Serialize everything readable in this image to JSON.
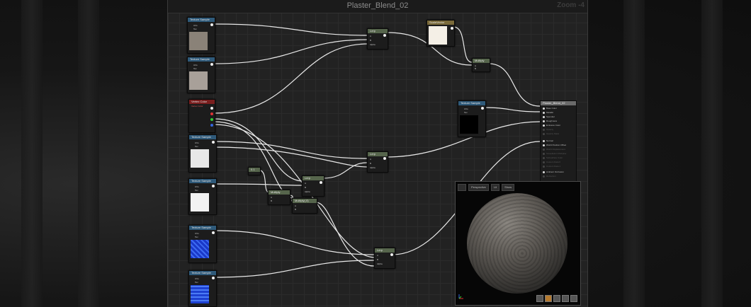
{
  "editor": {
    "title": "Plaster_Blend_02",
    "zoom": "Zoom -4"
  },
  "nodes": {
    "tex1": {
      "header": "Texture Sample",
      "pins": [
        "UVs",
        "Tex"
      ]
    },
    "tex2": {
      "header": "Texture Sample",
      "pins": [
        "UVs",
        "Tex"
      ]
    },
    "vertex_color": {
      "header": "Vertex Color",
      "sub": "Vertex Color",
      "pins": [
        "",
        "",
        "",
        ""
      ]
    },
    "tex3": {
      "header": "Texture Sample",
      "pins": [
        "UVs",
        "Tex"
      ]
    },
    "tex4": {
      "header": "Texture Sample",
      "pins": [
        "UVs",
        "Tex"
      ]
    },
    "tex5": {
      "header": "Texture Sample",
      "pins": [
        "UVs",
        "Tex"
      ]
    },
    "tex6": {
      "header": "Texture Sample",
      "pins": [
        "UVs",
        "Tex"
      ]
    },
    "tex7": {
      "header": "Texture Sample",
      "pins": [
        "UVs",
        "Tex"
      ]
    },
    "lerp1": {
      "header": "Lerp",
      "pins": [
        "A",
        "B",
        "Alpha"
      ]
    },
    "lerp2": {
      "header": "Lerp",
      "pins": [
        "A",
        "B",
        "Alpha"
      ]
    },
    "lerp3": {
      "header": "Lerp",
      "pins": [
        "A",
        "B",
        "Alpha"
      ]
    },
    "lerp4": {
      "header": "Lerp",
      "pins": [
        "A",
        "B",
        "Alpha"
      ]
    },
    "const1": {
      "header": "0.1"
    },
    "multiply1": {
      "header": "Multiply",
      "pins": [
        "A",
        "B"
      ]
    },
    "multiply2": {
      "header": "Multiply",
      "pins": [
        "A",
        "B"
      ]
    },
    "multiply3": {
      "header": "Multiply(,0)",
      "pins": [
        "A",
        "B"
      ]
    },
    "scalar": {
      "header": "ScaleVector"
    },
    "tex_dark": {
      "header": "Texture Sample",
      "pins": [
        "UVs",
        "Tex"
      ]
    },
    "result": {
      "header": "Plaster_Blend_02",
      "pins": [
        "Base Color",
        "Metallic",
        "Specular",
        "Roughness",
        "Emissive Color",
        "Opacity",
        "Opacity Mask",
        "Normal",
        "World Position Offset",
        "World Displacement",
        "Tessellation Multiplier",
        "Subsurface Color",
        "Custom Data 0",
        "Custom Data 1",
        "Ambient Occlusion",
        "Refraction"
      ]
    }
  },
  "preview": {
    "buttons": [
      "",
      "Perspective",
      "Lit",
      "Show"
    ]
  },
  "colors": {
    "texture_header": "#2f5a7a",
    "lerp_header": "#56654c",
    "wire": "#e8e8e8"
  }
}
